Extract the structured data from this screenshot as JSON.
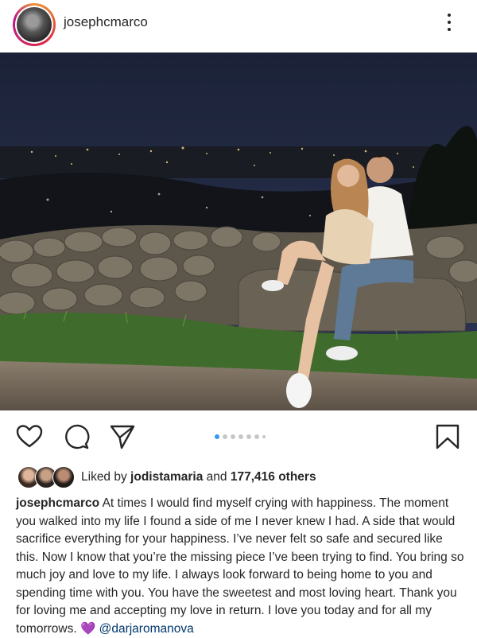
{
  "post": {
    "username": "josephcmarco",
    "liked_by_prefix": "Liked by",
    "liked_by_user": "jodistamaria",
    "liked_by_and": "and",
    "liked_by_count": "177,416 others",
    "caption_user": "josephcmarco",
    "caption_text": "At times I would find myself crying with happiness. The moment you walked into my life I found a side of me I never knew I had. A side that would sacrifice everything for your happiness. I’ve never felt so safe and secured like this. Now I know that you’re the missing piece I’ve been trying to find. You bring so much joy and love to my life. I always look forward to being home to you and spending time with you. You have the sweetest and most loving heart. Thank you for loving me and accepting my love in return. I love you today and for all my tomorrows.",
    "caption_emoji": "💜",
    "caption_mention": "@darjaromanova"
  },
  "carousel": {
    "total_dots": 7,
    "active_index": 0
  },
  "icons": {
    "more": "more-options-icon",
    "like": "heart-icon",
    "comment": "comment-icon",
    "share": "paper-plane-icon",
    "save": "bookmark-icon"
  },
  "colors": {
    "accent": "#3897f0",
    "text": "#262626",
    "mention": "#00376b",
    "emoji_heart": "#9b30d9"
  }
}
